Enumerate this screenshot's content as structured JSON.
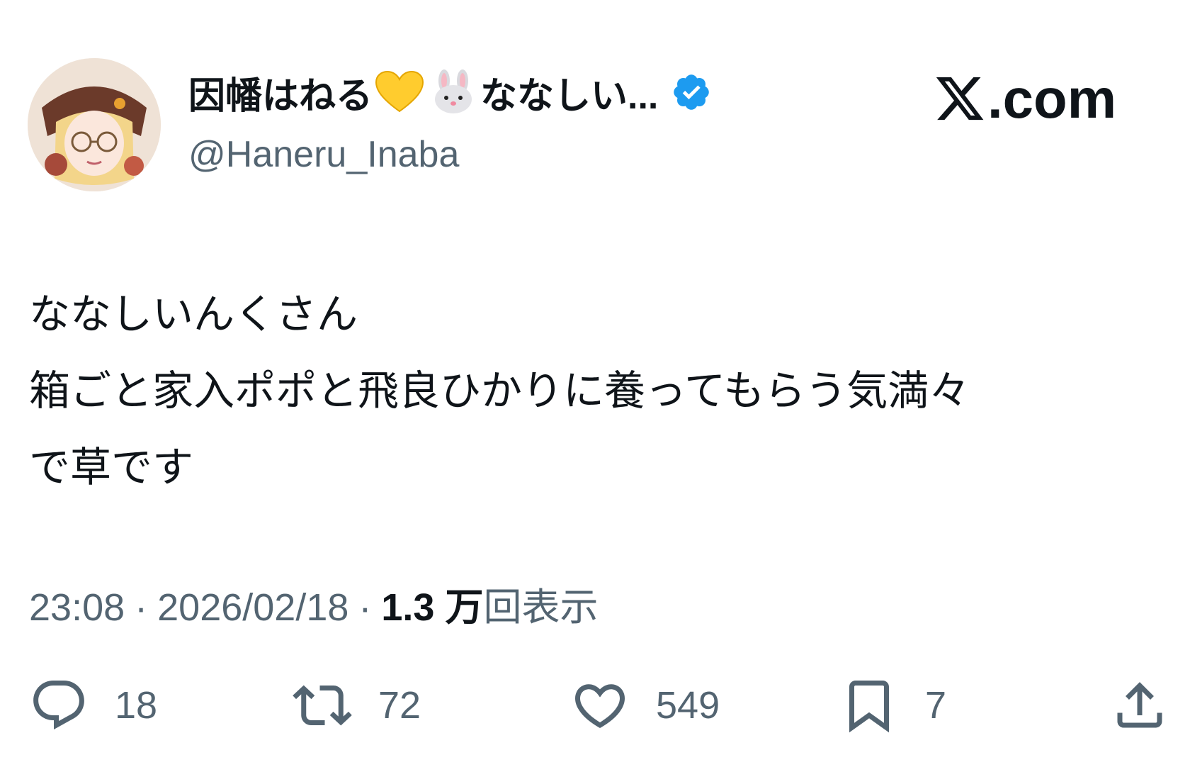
{
  "user": {
    "display_name_prefix": "因幡はねる",
    "display_name_emojis": [
      "yellow-heart-icon",
      "rabbit-face-icon"
    ],
    "display_name_suffix": "ななしい...",
    "handle": "@Haneru_Inaba",
    "verified": true,
    "verified_color": "#1d9bf0"
  },
  "brand": {
    "domain_text": ".com"
  },
  "tweet": {
    "lines": [
      "ななしいんくさん",
      "箱ごと家入ポポと飛良ひかりに養ってもらう気満々",
      "で草です"
    ],
    "time": "23:08",
    "separator": "·",
    "date": "2026/02/18",
    "views_count": "1.3 万",
    "views_label": "回表示"
  },
  "actions": {
    "replies": "18",
    "reposts": "72",
    "likes": "549",
    "bookmarks": "7"
  },
  "colors": {
    "text": "#0f1419",
    "secondary": "#536471",
    "accent": "#1d9bf0"
  }
}
